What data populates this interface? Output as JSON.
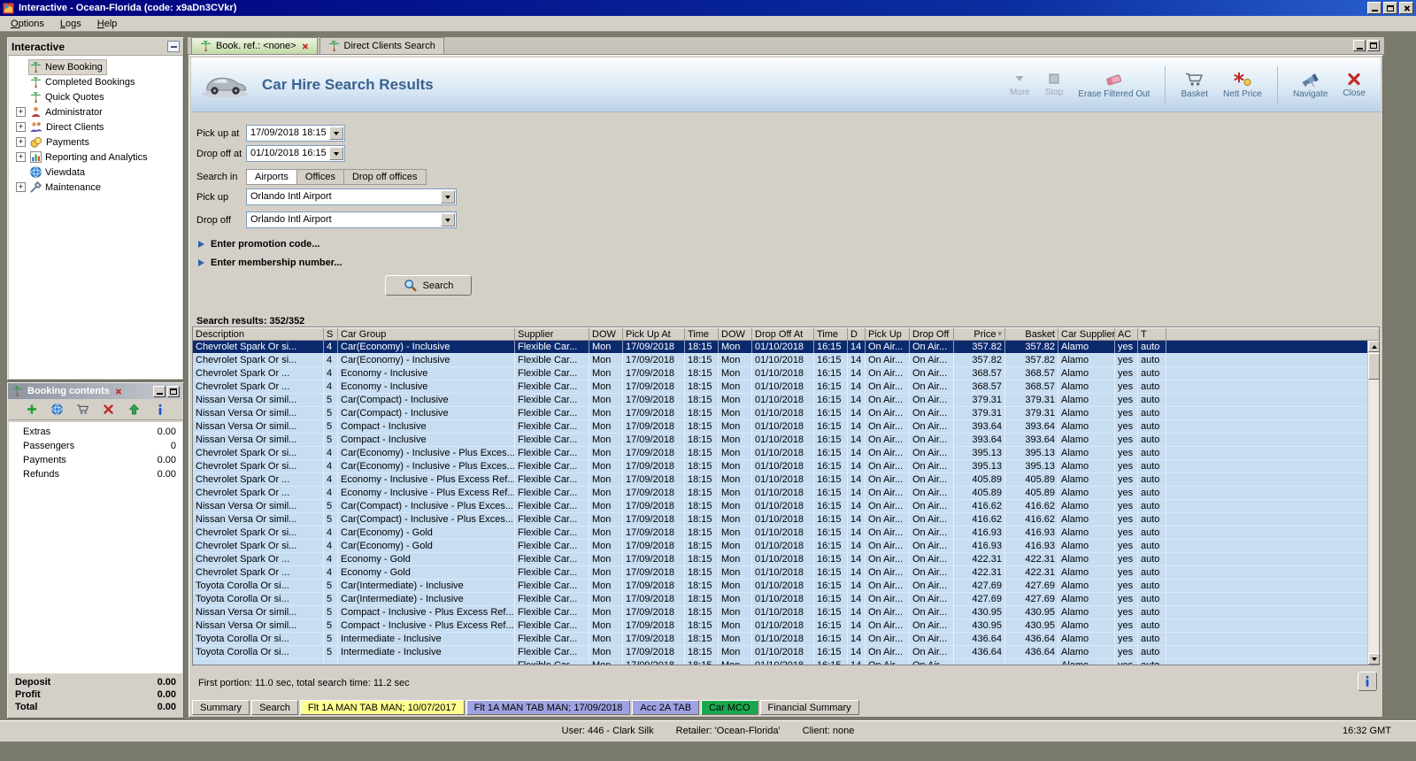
{
  "window": {
    "title": "Interactive - Ocean-Florida (code: x9aDn3CVkr)"
  },
  "menu": [
    "Options",
    "Logs",
    "Help"
  ],
  "sidebar": {
    "title": "Interactive",
    "items": [
      {
        "label": "New Booking",
        "icon": "palm",
        "selected": true
      },
      {
        "label": "Completed Bookings",
        "icon": "palm"
      },
      {
        "label": "Quick Quotes",
        "icon": "palm"
      },
      {
        "label": "Administrator",
        "icon": "person",
        "expandable": true
      },
      {
        "label": "Direct Clients",
        "icon": "people",
        "expandable": true
      },
      {
        "label": "Payments",
        "icon": "coins",
        "expandable": true
      },
      {
        "label": "Reporting and Analytics",
        "icon": "chart",
        "expandable": true
      },
      {
        "label": "Viewdata",
        "icon": "globe"
      },
      {
        "label": "Maintenance",
        "icon": "wrench",
        "expandable": true
      }
    ]
  },
  "booking_contents": {
    "title": "Booking contents",
    "toolbar": [
      {
        "name": "add",
        "icon": "add"
      },
      {
        "name": "refresh",
        "icon": "globe"
      },
      {
        "name": "basket",
        "icon": "cart16"
      },
      {
        "name": "delete",
        "icon": "deleteX"
      },
      {
        "name": "move-up",
        "icon": "up"
      },
      {
        "name": "info",
        "icon": "info"
      }
    ],
    "rows": [
      {
        "label": "Extras",
        "value": "0.00"
      },
      {
        "label": "Passengers",
        "value": "0"
      },
      {
        "label": "Payments",
        "value": "0.00"
      },
      {
        "label": "Refunds",
        "value": "0.00"
      }
    ],
    "totals": [
      {
        "label": "Deposit",
        "value": "0.00"
      },
      {
        "label": "Profit",
        "value": "0.00"
      },
      {
        "label": "Total",
        "value": "0.00"
      }
    ]
  },
  "main_tabs": [
    {
      "label": "Book. ref.: <none>",
      "active": true,
      "closable": true
    },
    {
      "label": "Direct Clients Search"
    }
  ],
  "header": {
    "title": "Car Hire Search Results",
    "toolbar": [
      {
        "label": "More",
        "icon": "more",
        "disabled": true
      },
      {
        "label": "Stop",
        "icon": "stop",
        "disabled": true
      },
      {
        "label": "Erase Filtered Out",
        "icon": "eraser"
      },
      {
        "label": "Basket",
        "icon": "cart22",
        "sep_before": true
      },
      {
        "label": "Nett Price",
        "icon": "nett"
      },
      {
        "label": "Navigate",
        "icon": "navigate",
        "sep_before": true
      },
      {
        "label": "Close",
        "icon": "closeX"
      }
    ]
  },
  "form": {
    "pickup_at_label": "Pick up at",
    "pickup_at_value": "17/09/2018 18:15",
    "dropoff_at_label": "Drop off at",
    "dropoff_at_value": "01/10/2018 16:15",
    "search_in_label": "Search in",
    "search_in_options": [
      "Airports",
      "Offices",
      "Drop off offices"
    ],
    "pickup_label": "Pick up",
    "pickup_value": "Orlando Intl Airport",
    "dropoff_label": "Drop off",
    "dropoff_value": "Orlando Intl Airport",
    "promo": "Enter promotion code...",
    "membership": "Enter membership number...",
    "search_button": "Search"
  },
  "results": {
    "summary": "Search results: 352/352",
    "sort_column": "Price",
    "columns": [
      "Description",
      "S",
      "Car Group",
      "Supplier",
      "DOW",
      "Pick Up At",
      "Time",
      "DOW",
      "Drop Off At",
      "Time",
      "D",
      "Pick Up",
      "Drop Off",
      "Price",
      "Basket",
      "Car Supplier",
      "AC",
      "T"
    ],
    "common": {
      "supplier": "Flexible Car...",
      "pick_dow": "Mon",
      "pick_date": "17/09/2018",
      "pick_time": "18:15",
      "drop_dow": "Mon",
      "drop_date": "01/10/2018",
      "drop_time": "16:15",
      "days": "14",
      "pick_up": "On Air...",
      "drop_off": "On Air...",
      "car_supplier": "Alamo",
      "ac": "yes",
      "transmission": "auto"
    },
    "rows": [
      {
        "description": "Chevrolet Spark Or si...",
        "seats": "4",
        "car_group": "Car(Economy) - Inclusive",
        "price": "357.82",
        "basket": "357.82",
        "selected": true
      },
      {
        "description": "Chevrolet Spark Or si...",
        "seats": "4",
        "car_group": "Car(Economy) - Inclusive",
        "price": "357.82",
        "basket": "357.82"
      },
      {
        "description": "Chevrolet Spark Or ...",
        "seats": "4",
        "car_group": "Economy - Inclusive",
        "price": "368.57",
        "basket": "368.57"
      },
      {
        "description": "Chevrolet Spark Or ...",
        "seats": "4",
        "car_group": "Economy - Inclusive",
        "price": "368.57",
        "basket": "368.57"
      },
      {
        "description": "Nissan Versa Or simil...",
        "seats": "5",
        "car_group": "Car(Compact) - Inclusive",
        "price": "379.31",
        "basket": "379.31"
      },
      {
        "description": "Nissan Versa Or simil...",
        "seats": "5",
        "car_group": "Car(Compact) - Inclusive",
        "price": "379.31",
        "basket": "379.31"
      },
      {
        "description": "Nissan Versa Or simil...",
        "seats": "5",
        "car_group": "Compact - Inclusive",
        "price": "393.64",
        "basket": "393.64"
      },
      {
        "description": "Nissan Versa Or simil...",
        "seats": "5",
        "car_group": "Compact - Inclusive",
        "price": "393.64",
        "basket": "393.64"
      },
      {
        "description": "Chevrolet Spark Or si...",
        "seats": "4",
        "car_group": "Car(Economy) - Inclusive - Plus Exces...",
        "price": "395.13",
        "basket": "395.13"
      },
      {
        "description": "Chevrolet Spark Or si...",
        "seats": "4",
        "car_group": "Car(Economy) - Inclusive - Plus Exces...",
        "price": "395.13",
        "basket": "395.13"
      },
      {
        "description": "Chevrolet Spark Or ...",
        "seats": "4",
        "car_group": "Economy - Inclusive - Plus Excess Ref...",
        "price": "405.89",
        "basket": "405.89"
      },
      {
        "description": "Chevrolet Spark Or ...",
        "seats": "4",
        "car_group": "Economy - Inclusive - Plus Excess Ref...",
        "price": "405.89",
        "basket": "405.89"
      },
      {
        "description": "Nissan Versa Or simil...",
        "seats": "5",
        "car_group": "Car(Compact) - Inclusive - Plus Exces...",
        "price": "416.62",
        "basket": "416.62"
      },
      {
        "description": "Nissan Versa Or simil...",
        "seats": "5",
        "car_group": "Car(Compact) - Inclusive - Plus Exces...",
        "price": "416.62",
        "basket": "416.62"
      },
      {
        "description": "Chevrolet Spark Or si...",
        "seats": "4",
        "car_group": "Car(Economy) - Gold",
        "price": "416.93",
        "basket": "416.93"
      },
      {
        "description": "Chevrolet Spark Or si...",
        "seats": "4",
        "car_group": "Car(Economy) - Gold",
        "price": "416.93",
        "basket": "416.93"
      },
      {
        "description": "Chevrolet Spark Or ...",
        "seats": "4",
        "car_group": "Economy - Gold",
        "price": "422.31",
        "basket": "422.31"
      },
      {
        "description": "Chevrolet Spark Or ...",
        "seats": "4",
        "car_group": "Economy - Gold",
        "price": "422.31",
        "basket": "422.31"
      },
      {
        "description": "Toyota Corolla Or si...",
        "seats": "5",
        "car_group": "Car(Intermediate) - Inclusive",
        "price": "427.69",
        "basket": "427.69"
      },
      {
        "description": "Toyota Corolla Or si...",
        "seats": "5",
        "car_group": "Car(Intermediate) - Inclusive",
        "price": "427.69",
        "basket": "427.69"
      },
      {
        "description": "Nissan Versa Or simil...",
        "seats": "5",
        "car_group": "Compact - Inclusive - Plus Excess Ref...",
        "price": "430.95",
        "basket": "430.95"
      },
      {
        "description": "Nissan Versa Or simil...",
        "seats": "5",
        "car_group": "Compact - Inclusive - Plus Excess Ref...",
        "price": "430.95",
        "basket": "430.95"
      },
      {
        "description": "Toyota Corolla Or si...",
        "seats": "5",
        "car_group": "Intermediate - Inclusive",
        "price": "436.64",
        "basket": "436.64"
      },
      {
        "description": "Toyota Corolla Or si...",
        "seats": "5",
        "car_group": "Intermediate - Inclusive",
        "price": "436.64",
        "basket": "436.64"
      },
      {
        "description": "",
        "seats": "",
        "car_group": "",
        "price": "",
        "basket": "",
        "partial": true
      }
    ]
  },
  "status": {
    "text": "First portion: 11.0 sec, total search time: 11.2 sec"
  },
  "bottom_tabs": [
    {
      "label": "Summary"
    },
    {
      "label": "Search"
    },
    {
      "label": "Flt 1A MAN TAB MAN; 10/07/2017",
      "bg": "#FFFE8F"
    },
    {
      "label": "Flt 1A MAN TAB MAN; 17/09/2018",
      "bg": "#9FA2E2"
    },
    {
      "label": "Acc 2A TAB",
      "bg": "#9FA2E2"
    },
    {
      "label": "Car MCO",
      "bg": "#19A84E"
    },
    {
      "label": "Financial Summary"
    }
  ],
  "statusbar": {
    "user": "User: 446 - Clark Silk",
    "retailer": "Retailer: 'Ocean-Florida'",
    "client": "Client: none",
    "time": "16:32 GMT"
  }
}
